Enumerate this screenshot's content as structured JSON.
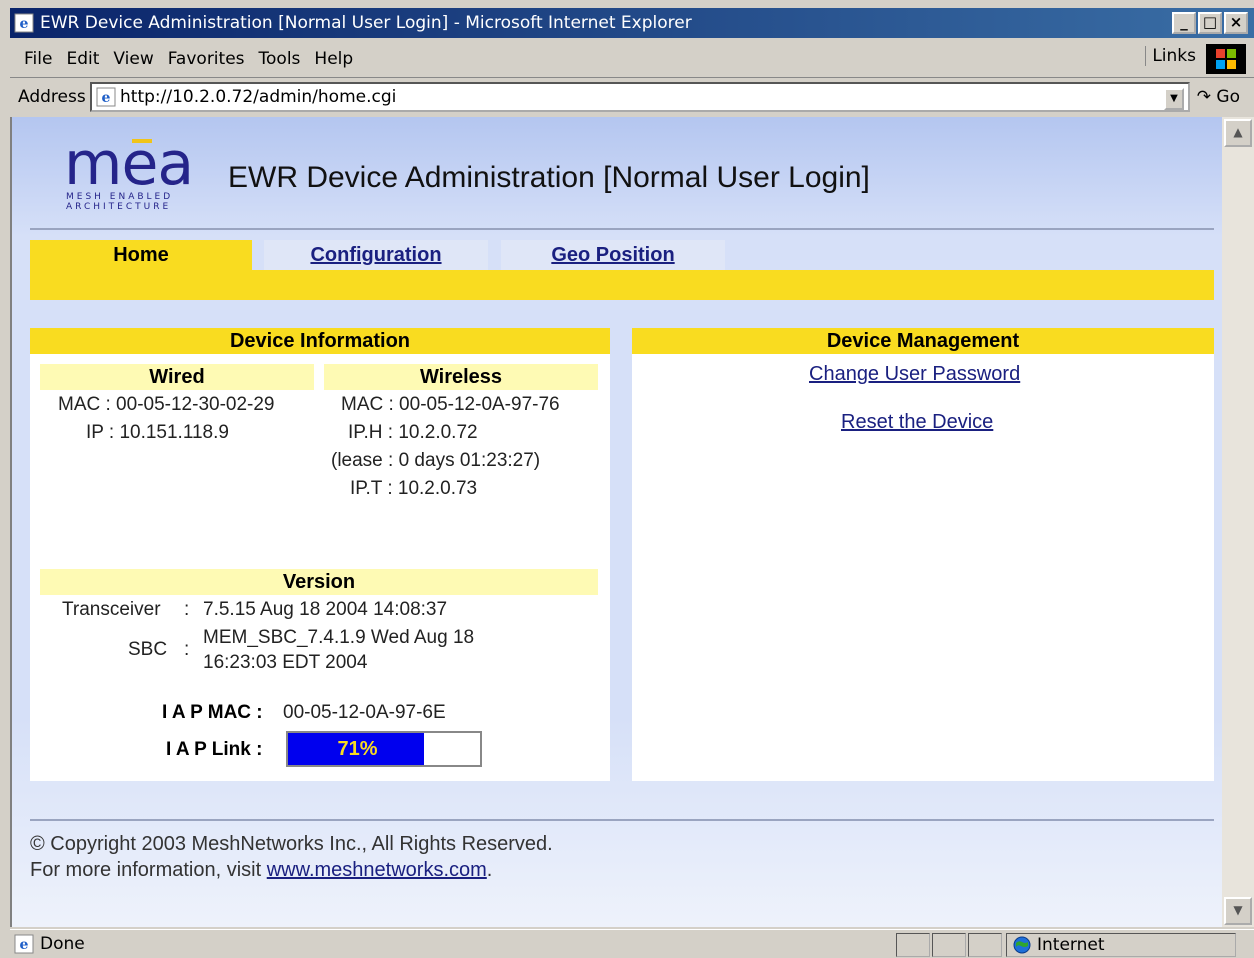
{
  "window": {
    "title": "EWR Device Administration [Normal User Login] - Microsoft Internet Explorer",
    "min_glyph": "_",
    "max_glyph": "□",
    "close_glyph": "×"
  },
  "menu": {
    "items": [
      "File",
      "Edit",
      "View",
      "Favorites",
      "Tools",
      "Help"
    ],
    "links": "Links"
  },
  "address": {
    "label": "Address",
    "url": "http://10.2.0.72/admin/home.cgi",
    "go": "Go"
  },
  "page": {
    "logo_text": "mea",
    "logo_tagline_1": "MESH ENABLED",
    "logo_tagline_2": "ARCHITECTURE",
    "title": "EWR Device Administration [Normal User Login]"
  },
  "tabs": [
    {
      "label": "Home",
      "active": true
    },
    {
      "label": "Configuration",
      "active": false
    },
    {
      "label": "Geo Position",
      "active": false
    }
  ],
  "device_info": {
    "heading": "Device Information",
    "wired": {
      "heading": "Wired",
      "mac": "MAC : 00-05-12-30-02-29",
      "ip": "IP : 10.151.118.9"
    },
    "wireless": {
      "heading": "Wireless",
      "mac": "MAC : 00-05-12-0A-97-76",
      "iph": "IP.H : 10.2.0.72",
      "lease": "(lease : 0 days 01:23:27)",
      "ipt": "IP.T : 10.2.0.73"
    },
    "version": {
      "heading": "Version",
      "transceiver_label": "Transceiver",
      "transceiver_value": "7.5.15 Aug 18 2004 14:08:37",
      "sbc_label": "SBC",
      "sbc_value_1": "MEM_SBC_7.4.1.9 Wed Aug 18",
      "sbc_value_2": "16:23:03 EDT 2004",
      "sep": ":"
    },
    "iap_mac_label": "I A P MAC :",
    "iap_mac_value": "00-05-12-0A-97-6E",
    "iap_link_label": "I A P Link :",
    "iap_link_text": "71%",
    "iap_link_percent": 71
  },
  "device_mgmt": {
    "heading": "Device Management",
    "change_password": "Change User Password",
    "reset": "Reset the Device"
  },
  "footer": {
    "copyright": "© Copyright 2003 MeshNetworks Inc., All Rights Reserved.",
    "more_info": "For more information, visit",
    "link": "www.meshnetworks.com",
    "period": "."
  },
  "status": {
    "text": "Done",
    "zone": "Internet"
  },
  "colors": {
    "accent_yellow": "#f9dc20",
    "pale_yellow": "#fefab4",
    "link_blue": "#1a2080",
    "progress_blue": "#0000ee"
  }
}
